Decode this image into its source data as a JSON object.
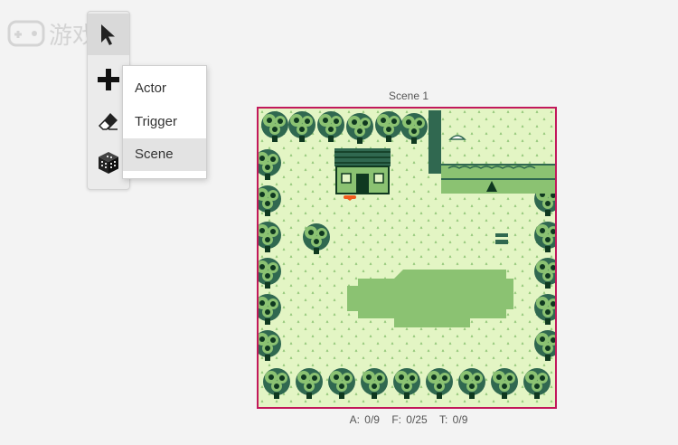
{
  "watermark": {
    "text": "游戏机"
  },
  "toolbar": {
    "tools": [
      {
        "name": "select",
        "icon": "cursor-icon",
        "active": true
      },
      {
        "name": "add",
        "icon": "plus-icon",
        "active": false
      },
      {
        "name": "eraser",
        "icon": "eraser-icon",
        "active": false
      },
      {
        "name": "colors",
        "icon": "palette-cube-icon",
        "active": false
      }
    ]
  },
  "add_menu": {
    "items": [
      {
        "label": "Actor"
      },
      {
        "label": "Trigger"
      },
      {
        "label": "Scene",
        "highlighted": true
      }
    ]
  },
  "scene": {
    "title": "Scene 1",
    "border_color": "#c2185b",
    "stats": {
      "actors": "A: 0/9",
      "frames": "F: 0/25",
      "triggers": "T: 0/9"
    },
    "palette": {
      "lightest": "#e3f5c4",
      "light": "#8bc272",
      "dark": "#306850",
      "darkest": "#0f3820"
    }
  }
}
